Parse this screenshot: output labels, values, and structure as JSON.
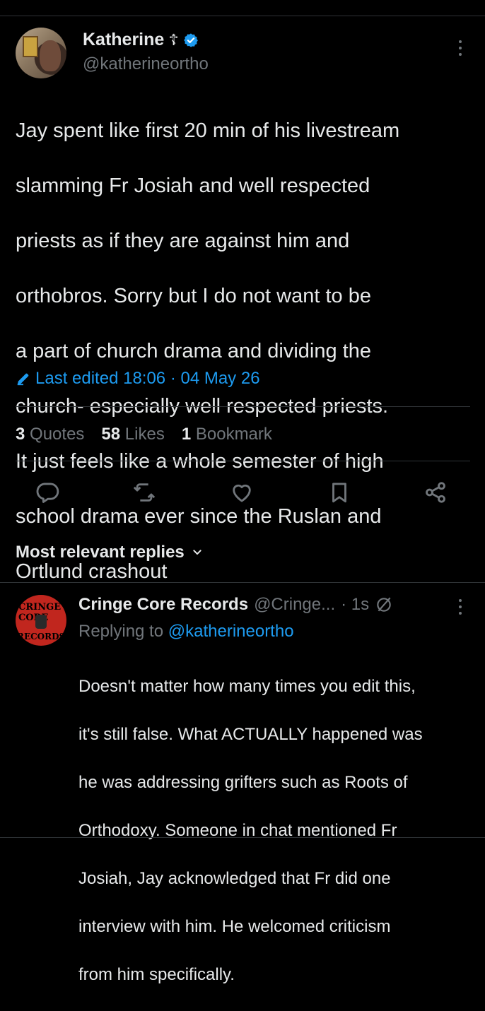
{
  "post": {
    "display_name": "Katherine",
    "cross_glyph": "☦",
    "handle": "@katherineortho",
    "text_lines": [
      "Jay spent like first 20 min of his livestream",
      "slamming Fr Josiah and well respected",
      "priests as if they are against him and",
      "orthobros. Sorry but I do not want to be",
      "a part of church drama and dividing the",
      "church- especially well respected priests.",
      "It just feels like a whole semester of high",
      "school drama ever since the Ruslan and",
      "Ortlund crashout"
    ],
    "edited_label": "Last edited 18:06 · 04 May 26",
    "stats": {
      "quotes_num": "3",
      "quotes_label": "Quotes",
      "likes_num": "58",
      "likes_label": "Likes",
      "bookmarks_num": "1",
      "bookmarks_label": "Bookmark"
    },
    "actions": [
      "reply-icon",
      "repost-icon",
      "like-icon",
      "bookmark-icon",
      "share-icon"
    ]
  },
  "replies_header": "Most relevant replies",
  "reply": {
    "avatar_text_top": "CRINGE CORE",
    "avatar_text_bottom": "RECORDS",
    "display_name": "Cringe Core Records",
    "handle": "@Cringe...",
    "time": "· 1s",
    "replying_prefix": "Replying to",
    "replying_mention": "@katherineortho",
    "text_lines": [
      "Doesn't matter how many times you edit this,",
      "it's still false. What ACTUALLY happened was",
      "he was addressing grifters such as Roots of",
      "Orthodoxy. Someone in chat mentioned Fr",
      "Josiah, Jay acknowledged that Fr did one",
      "interview with him. He welcomed criticism",
      "from him specifically."
    ]
  },
  "colors": {
    "background": "#000000",
    "text": "#e7e9ea",
    "muted": "#71767b",
    "accent": "#1d9bf0",
    "divider": "#2f3336"
  }
}
